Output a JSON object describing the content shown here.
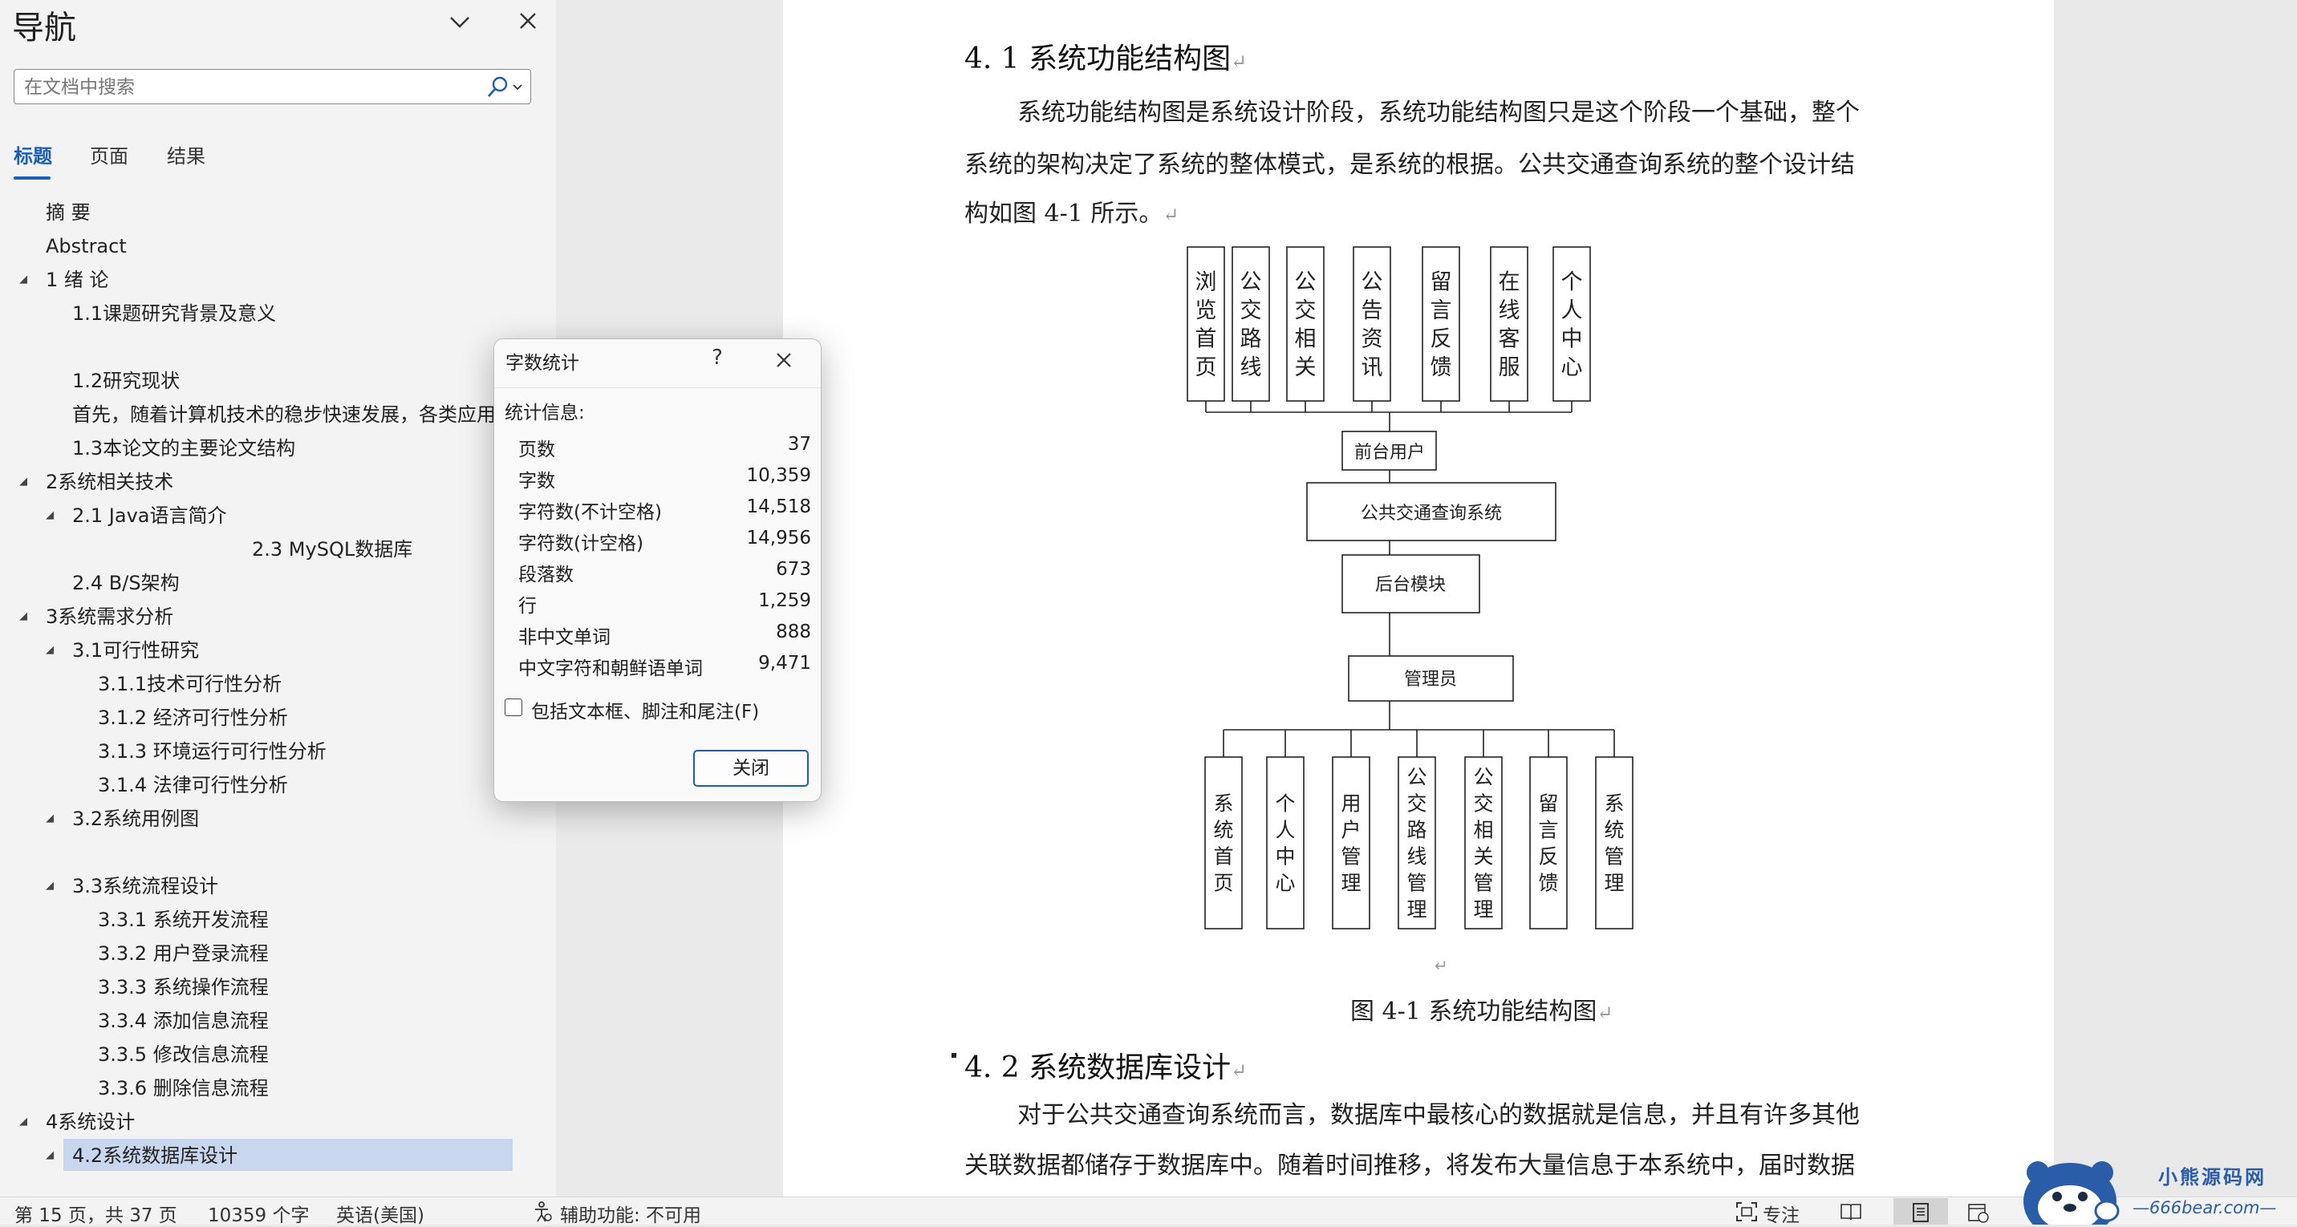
{
  "nav": {
    "title": "导航",
    "search_placeholder": "在文档中搜索",
    "tabs": [
      "标题",
      "页面",
      "结果"
    ],
    "tree": [
      {
        "label": "摘  要"
      },
      {
        "label": "Abstract"
      },
      {
        "label": "1 绪  论"
      },
      {
        "label": "1.1课题研究背景及意义"
      },
      {
        "label": "1.2研究现状"
      },
      {
        "label": "首先，随着计算机技术的稳步快速发展，各类应用"
      },
      {
        "label": "1.3本论文的主要论文结构"
      },
      {
        "label": "2系统相关技术"
      },
      {
        "label": "2.1 Java语言简介"
      },
      {
        "label": "2.3 MySQL数据库"
      },
      {
        "label": "2.4 B/S架构"
      },
      {
        "label": "3系统需求分析"
      },
      {
        "label": "3.1可行性研究"
      },
      {
        "label": "3.1.1技术可行性分析"
      },
      {
        "label": "3.1.2 经济可行性分析"
      },
      {
        "label": "3.1.3 环境运行可行性分析"
      },
      {
        "label": "3.1.4 法律可行性分析"
      },
      {
        "label": "3.2系统用例图"
      },
      {
        "label": "3.3系统流程设计"
      },
      {
        "label": "3.3.1 系统开发流程"
      },
      {
        "label": "3.3.2 用户登录流程"
      },
      {
        "label": "3.3.3 系统操作流程"
      },
      {
        "label": "3.3.4 添加信息流程"
      },
      {
        "label": "3.3.5 修改信息流程"
      },
      {
        "label": "3.3.6 删除信息流程"
      },
      {
        "label": "4系统设计"
      },
      {
        "label": "4.2系统数据库设计",
        "selected": true
      }
    ]
  },
  "document": {
    "heading1": "4. 1 系统功能结构图",
    "para1_lines": [
      "系统功能结构图是系统设计阶段，系统功能结构图只是这个阶段一个基础，整个",
      "系统的架构决定了系统的整体模式，是系统的根据。公共交通查询系统的整个设计结",
      "构如图 4-1 所示。"
    ],
    "diagram": {
      "top_modules": [
        "浏览首页",
        "公交路线",
        "公交相关",
        "公告资讯",
        "留言反馈",
        "在线客服",
        "个人中心"
      ],
      "front_user": "前台用户",
      "system": "公共交通查询系统",
      "backend": "后台模块",
      "admin": "管理员",
      "bottom_modules": [
        "系统首页",
        "个人中心",
        "用户管理",
        "公交路线管理",
        "公交相关管理",
        "留言反馈",
        "系统管理"
      ]
    },
    "caption": "图 4-1 系统功能结构图",
    "heading2": "4. 2 系统数据库设计",
    "para2_lines": [
      "对于公共交通查询系统而言，数据库中最核心的数据就是信息，并且有许多其他",
      "关联数据都储存于数据库中。随着时间推移，将发布大量信息于本系统中，届时数据"
    ],
    "para_mark": "↵"
  },
  "dialog": {
    "title": "字数统计",
    "help": "?",
    "section": "统计信息:",
    "stats": [
      {
        "label": "页数",
        "value": "37"
      },
      {
        "label": "字数",
        "value": "10,359"
      },
      {
        "label": "字符数(不计空格)",
        "value": "14,518"
      },
      {
        "label": "字符数(计空格)",
        "value": "14,956"
      },
      {
        "label": "段落数",
        "value": "673"
      },
      {
        "label": "行",
        "value": "1,259"
      },
      {
        "label": "非中文单词",
        "value": "888"
      },
      {
        "label": "中文字符和朝鲜语单词",
        "value": "9,471"
      }
    ],
    "checkbox_label": "包括文本框、脚注和尾注(F)",
    "checkbox_checked": false,
    "close_button": "关闭"
  },
  "status": {
    "page": "第 15 页，共 37 页",
    "words": "10359 个字",
    "language": "英语(美国)",
    "accessibility": "辅助功能: 不可用",
    "focus": "专注"
  },
  "watermark": {
    "text": "小熊源码网",
    "url": "—666bear.com—"
  },
  "colors": {
    "accent": "#1a5fb4",
    "selection": "#c8d7ee"
  }
}
